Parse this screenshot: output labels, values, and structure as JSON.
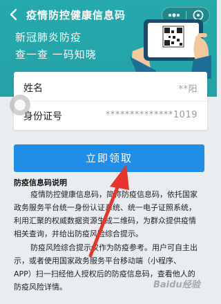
{
  "navbar": {
    "title": "疫情防控健康信息码",
    "back_icon": "back-arrow-icon",
    "more_icon": "more-dots-icon",
    "close_icon": "close-circle-icon"
  },
  "hero": {
    "line1": "新冠肺炎防疫",
    "line2": "查一查 一码知晓",
    "illustration_icon": "phone-qr-code-icon"
  },
  "form": {
    "rows": [
      {
        "label": "姓名",
        "value": "**阳"
      },
      {
        "label": "身份证号",
        "value": "**************1019"
      }
    ]
  },
  "primary_button": {
    "label": "立即领取"
  },
  "notice": {
    "title": "防疫信息码说明",
    "paragraph1_lines": [
      "疫情防控健康信息码，简称防疫信息码，依托国家",
      "政务服务平台统一身份认证系统、统一电子证照系统，",
      "利用汇聚的权威数据资源生成二维码，为群众提供疫情",
      "相关查询，并给出防疫风险综合提示。"
    ],
    "paragraph2_lines": [
      "防疫风险综合提示仅作为防疫参考。用户可自主出",
      "示，或者使用国家政务服务平台移动端（小程序、",
      "APP）扫一扫经他人授权后的防疫信息码，查看他人的",
      "防疫风险详情。"
    ]
  },
  "watermark": {
    "text": "Baidu经验"
  },
  "colors": {
    "hero_bg": "#25a9ad",
    "primary": "#1f8ee8",
    "arrow": "#e8352b",
    "page_bg": "#e9edf0"
  }
}
